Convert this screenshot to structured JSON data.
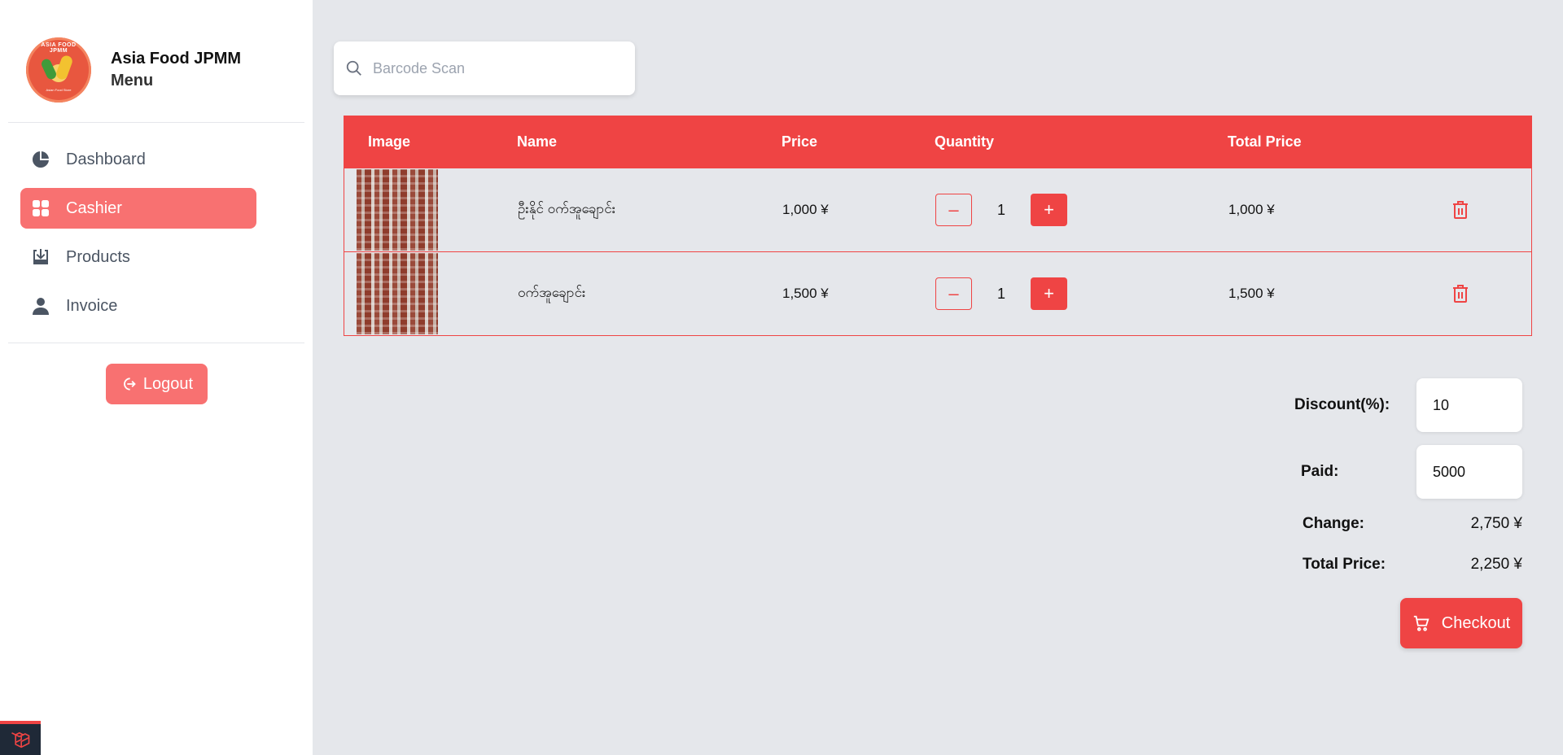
{
  "brand": {
    "title": "Asia Food JPMM",
    "subtitle": "Menu",
    "logo_text": "ASIA FOOD JPMM",
    "logo_sub": "Asian Food Store"
  },
  "sidebar": {
    "items": [
      {
        "label": "Dashboard",
        "icon": "pie-chart-icon"
      },
      {
        "label": "Cashier",
        "icon": "grid-icon",
        "active": true
      },
      {
        "label": "Products",
        "icon": "download-box-icon"
      },
      {
        "label": "Invoice",
        "icon": "user-icon"
      }
    ],
    "logout_label": "Logout"
  },
  "search": {
    "placeholder": "Barcode Scan"
  },
  "table": {
    "headers": {
      "image": "Image",
      "name": "Name",
      "price": "Price",
      "quantity": "Quantity",
      "total": "Total Price"
    },
    "rows": [
      {
        "name": "ဦးနိုင် ဝက်အူချောင်း",
        "price": "1,000 ¥",
        "quantity": "1",
        "total": "1,000 ¥"
      },
      {
        "name": "ဝက်အူချောင်း",
        "price": "1,500 ¥",
        "quantity": "1",
        "total": "1,500 ¥"
      }
    ],
    "minus_label": "–",
    "plus_label": "+"
  },
  "summary": {
    "discount_label": "Discount(%):",
    "discount_value": "10",
    "paid_label": "Paid:",
    "paid_value": "5000",
    "change_label": "Change:",
    "change_value": "2,750 ¥",
    "total_label": "Total Price:",
    "total_value": "2,250 ¥"
  },
  "checkout_label": "Checkout",
  "colors": {
    "accent": "#ef4444",
    "accent_light": "#f87171",
    "background": "#e5e7eb"
  }
}
